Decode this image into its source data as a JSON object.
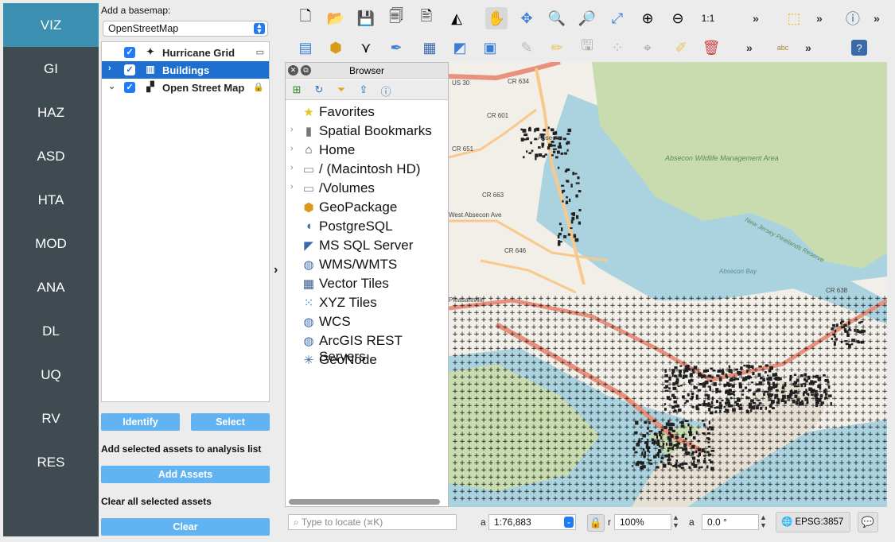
{
  "nav": {
    "items": [
      "VIZ",
      "GI",
      "HAZ",
      "ASD",
      "HTA",
      "MOD",
      "ANA",
      "DL",
      "UQ",
      "RV",
      "RES"
    ],
    "active": "VIZ"
  },
  "layers_panel": {
    "basemap_label": "Add a basemap:",
    "basemap_value": "OpenStreetMap",
    "layers": [
      {
        "name": "Hurricane Grid",
        "checked": true,
        "selected": false
      },
      {
        "name": "Buildings",
        "checked": true,
        "selected": true
      },
      {
        "name": "Open Street Map",
        "checked": true,
        "selected": false
      }
    ],
    "identify_label": "Identify",
    "select_label": "Select",
    "add_assets_heading": "Add selected assets to analysis list",
    "add_assets_label": "Add Assets",
    "clear_heading": "Clear all selected assets",
    "clear_label": "Clear"
  },
  "browser": {
    "title": "Browser",
    "items": [
      {
        "label": "Favorites",
        "icon": "star-icon",
        "expandable": false
      },
      {
        "label": "Spatial Bookmarks",
        "icon": "bookmark-icon",
        "expandable": true
      },
      {
        "label": "Home",
        "icon": "home-icon",
        "expandable": true
      },
      {
        "label": "/ (Macintosh HD)",
        "icon": "folder-icon",
        "expandable": true
      },
      {
        "label": "/Volumes",
        "icon": "folder-icon",
        "expandable": true
      },
      {
        "label": "GeoPackage",
        "icon": "geopackage-icon",
        "expandable": false
      },
      {
        "label": "PostgreSQL",
        "icon": "elephant-icon",
        "expandable": false
      },
      {
        "label": "MS SQL Server",
        "icon": "mssql-icon",
        "expandable": false
      },
      {
        "label": "WMS/WMTS",
        "icon": "globe-icon",
        "expandable": false
      },
      {
        "label": "Vector Tiles",
        "icon": "grid-icon",
        "expandable": false
      },
      {
        "label": "XYZ Tiles",
        "icon": "dots-grid-icon",
        "expandable": false
      },
      {
        "label": "WCS",
        "icon": "globe-icon",
        "expandable": false
      },
      {
        "label": "ArcGIS REST Servers",
        "icon": "globe-icon",
        "expandable": false
      },
      {
        "label": "GeoNode",
        "icon": "geonode-icon",
        "expandable": false
      }
    ]
  },
  "map": {
    "labels": [
      "US 30",
      "CR 634",
      "CR 601",
      "CR 651",
      "CR 663",
      "CR 646",
      "CR 638",
      "Absecon",
      "Absecon Wildlife Management Area",
      "New Jersey Pinelands Reserve",
      "West Absecon Ave",
      "Absecon Bay",
      "Pleasantville"
    ],
    "colors": {
      "water": "#aad3df",
      "land": "#f2efe9",
      "marsh": "#c9dcb0",
      "road_major": "#e8917d",
      "road_minor": "#f7c98c",
      "grid": "#111111",
      "buildings": "#222222"
    }
  },
  "statusbar": {
    "locate_placeholder": "Type to locate (⌘K)",
    "coordinate_label": "a",
    "scale_value": "1:76,883",
    "magnifier_label": "r",
    "magnifier_value": "100%",
    "rotation_label": "a",
    "rotation_value": "0.0 °",
    "crs_label": "EPSG:3857"
  }
}
